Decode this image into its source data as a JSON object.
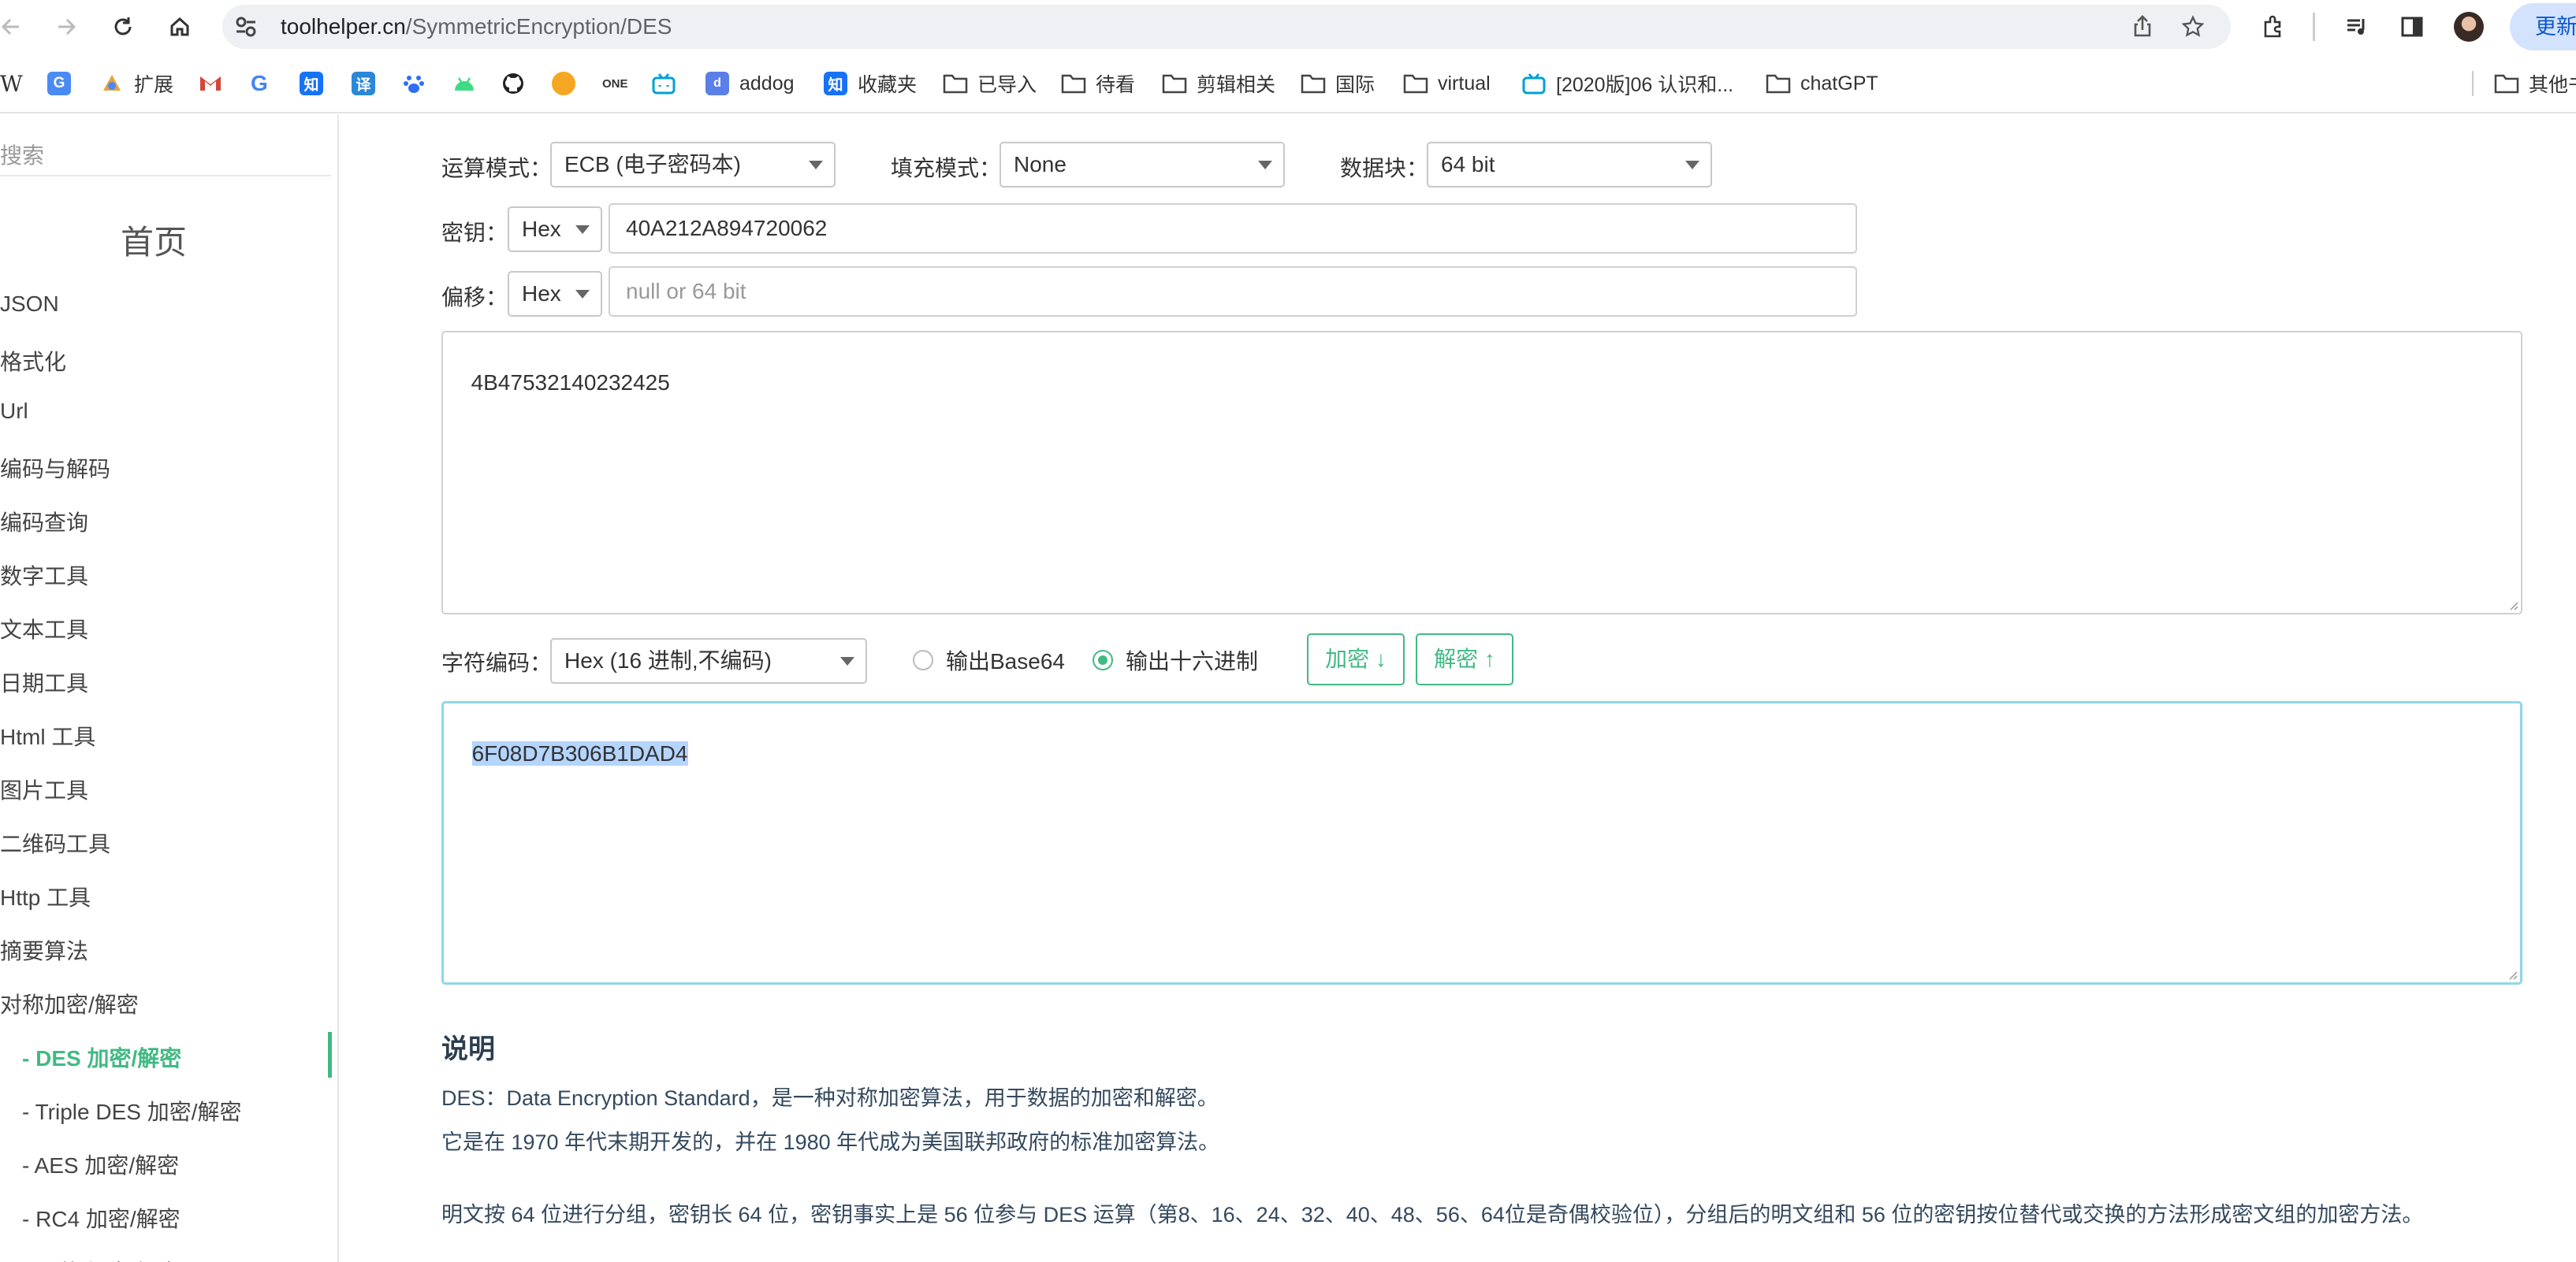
{
  "browser": {
    "url_host": "toolhelper.cn",
    "url_path": "/SymmetricEncryption/DES",
    "update_label": "更新",
    "bookmarks": [
      {
        "label": "扩展",
        "icon": "extensions-bookmark-icon"
      },
      {
        "label": "addog",
        "icon": "addog-icon"
      },
      {
        "label": "收藏夹",
        "icon": "zhihu-icon"
      },
      {
        "label": "已导入",
        "icon": "folder-icon"
      },
      {
        "label": "待看",
        "icon": "folder-icon"
      },
      {
        "label": "剪辑相关",
        "icon": "folder-icon"
      },
      {
        "label": "国际",
        "icon": "folder-icon"
      },
      {
        "label": "virtual",
        "icon": "folder-icon"
      },
      {
        "label": "[2020版]06 认识和...",
        "icon": "bilibili-icon"
      },
      {
        "label": "chatGPT",
        "icon": "folder-icon"
      },
      {
        "label": "其他书",
        "icon": "folder-icon"
      }
    ]
  },
  "sidebar": {
    "search_placeholder": "搜索",
    "home": "首页",
    "items": [
      "JSON",
      "格式化",
      "Url",
      "编码与解码",
      "编码查询",
      "数字工具",
      "文本工具",
      "日期工具",
      "Html 工具",
      "图片工具",
      "二维码工具",
      "Http 工具",
      "摘要算法",
      "对称加密/解密"
    ],
    "sub_items": [
      "- DES  加密/解密",
      "- Triple DES  加密/解密",
      "- AES  加密/解密",
      "- RC4  加密/解密",
      "- 月节  加密/解密"
    ]
  },
  "form": {
    "mode_label": "运算模式：",
    "mode_value": "ECB (电子密码本)",
    "padding_label": "填充模式：",
    "padding_value": "None",
    "block_label": "数据块：",
    "block_value": "64 bit",
    "key_label": "密钥：",
    "key_format": "Hex",
    "key_value": "40A212A894720062",
    "iv_label": "偏移：",
    "iv_format": "Hex",
    "iv_placeholder": "null or 64 bit",
    "input_text": "4B47532140232425",
    "charset_label": "字符编码：",
    "charset_value": "Hex (16 进制,不编码)",
    "radio_base64": "输出Base64",
    "radio_hex": "输出十六进制",
    "selected_output": "hex",
    "encrypt_label": "加密 ↓",
    "decrypt_label": "解密 ↑",
    "output_text": "6F08D7B306B1DAD4"
  },
  "description": {
    "title": "说明",
    "line1": "DES：Data Encryption Standard，是一种对称加密算法，用于数据的加密和解密。",
    "line2": "它是在 1970 年代末期开发的，并在 1980 年代成为美国联邦政府的标准加密算法。",
    "line3": "明文按 64 位进行分组，密钥长 64 位，密钥事实上是 56 位参与 DES 运算（第8、16、24、32、40、48、56、64位是奇偶校验位），分组后的明文组和 56 位的密钥按位替代或交换的方法形成密文组的加密方法。"
  },
  "colors": {
    "accent": "#42b983",
    "url_bar": "#eef0f4",
    "update_button": "#d3e3fd"
  }
}
